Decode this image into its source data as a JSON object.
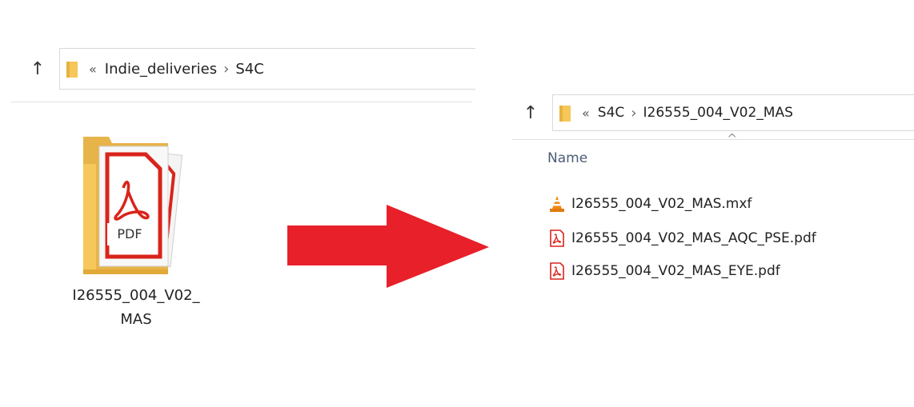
{
  "left_window": {
    "breadcrumb": [
      "Indie_deliveries",
      "S4C"
    ],
    "folder": {
      "name_line1": "I26555_004_V02_",
      "name_line2": "MAS",
      "preview_label": "PDF"
    }
  },
  "right_window": {
    "breadcrumb": [
      "S4C",
      "I26555_004_V02_MAS"
    ],
    "column_header": "Name",
    "files": [
      {
        "name": "I26555_004_V02_MAS.mxf",
        "icon": "vlc-cone-icon"
      },
      {
        "name": "I26555_004_V02_MAS_AQC_PSE.pdf",
        "icon": "pdf-icon"
      },
      {
        "name": "I26555_004_V02_MAS_EYE.pdf",
        "icon": "pdf-icon"
      }
    ]
  },
  "colors": {
    "arrow": "#e8202a",
    "folder": "#f6c75a",
    "pdf_red": "#d9241b"
  },
  "glyphs": {
    "up": "↑",
    "overflow": "«",
    "chevron": "›",
    "sort": "^"
  }
}
